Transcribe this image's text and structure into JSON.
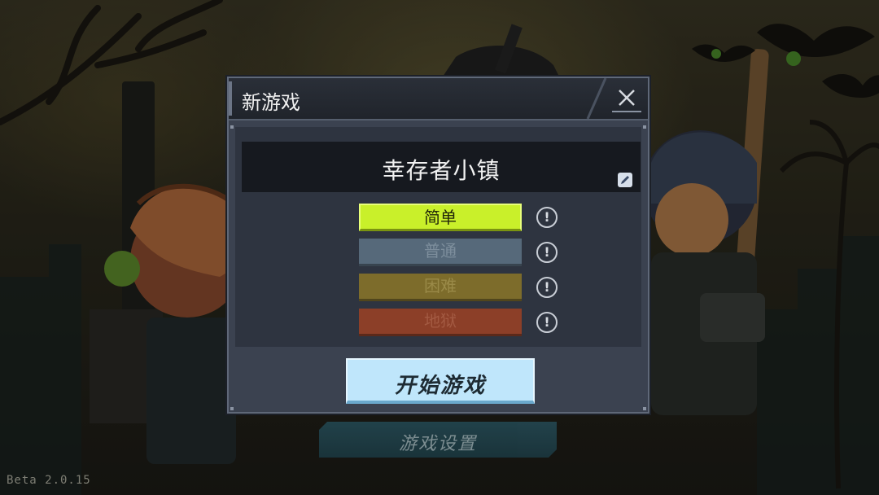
{
  "dialog": {
    "title": "新游戏",
    "close_icon": "close-icon"
  },
  "town": {
    "name": "幸存者小镇",
    "edit_icon": "pencil-icon"
  },
  "difficulties": [
    {
      "label": "简单",
      "selected": true,
      "color": "#c9f02a"
    },
    {
      "label": "普通",
      "selected": false,
      "color": "#56697a"
    },
    {
      "label": "困难",
      "selected": false,
      "color": "#7d6c2b"
    },
    {
      "label": "地狱",
      "selected": false,
      "color": "#8c3f28"
    }
  ],
  "info_icon": {
    "glyph": "!"
  },
  "start_button": {
    "label": "开始游戏"
  },
  "settings_button": {
    "label": "游戏设置"
  },
  "version": "Beta 2.0.15"
}
